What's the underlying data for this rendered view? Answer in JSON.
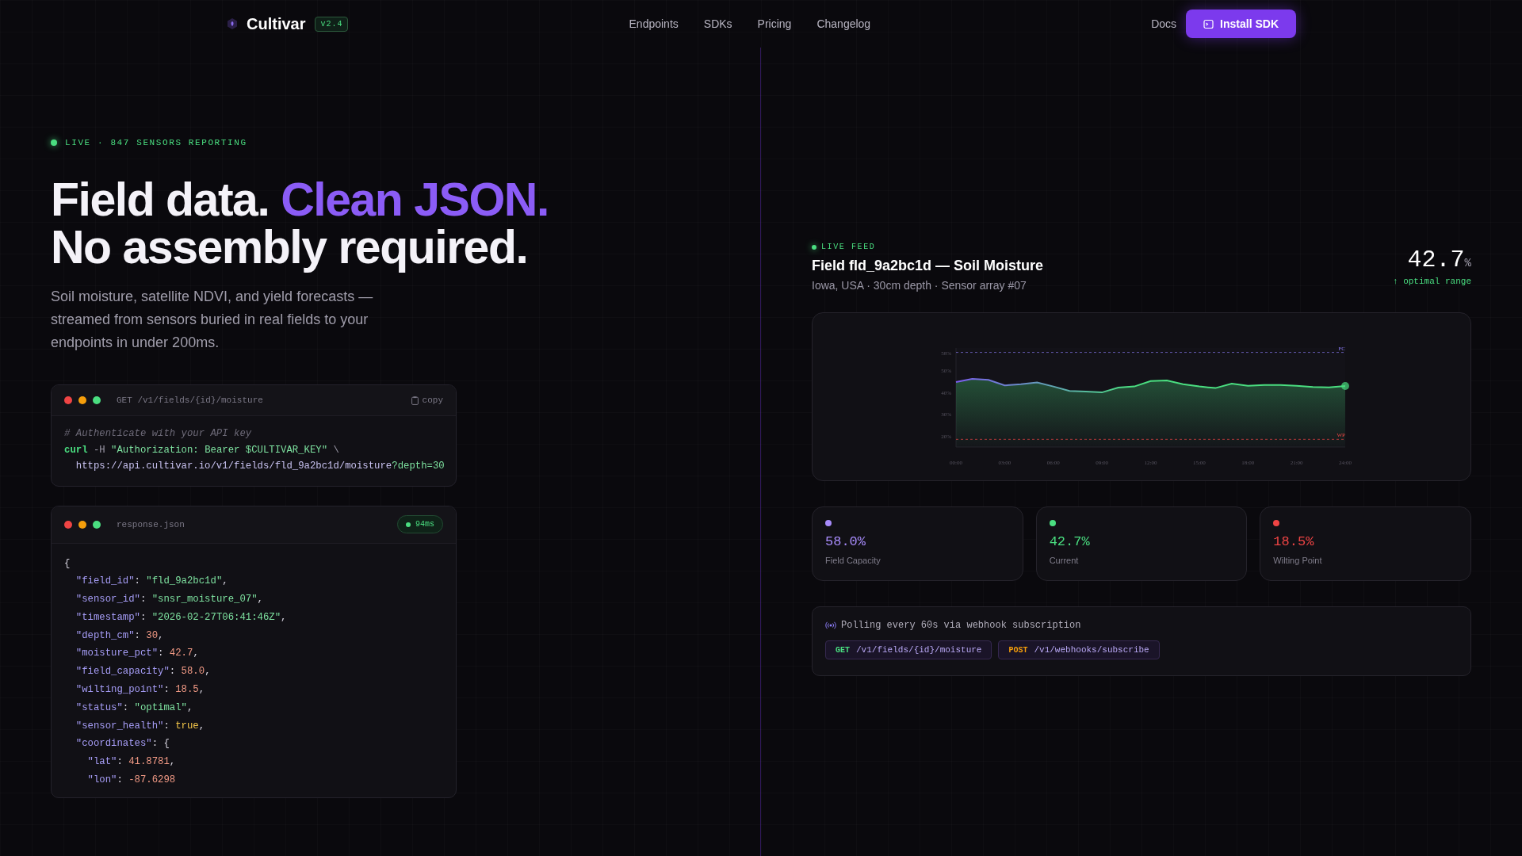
{
  "nav": {
    "brand": "Cultivar",
    "version": "v2.4",
    "links": [
      "Endpoints",
      "SDKs",
      "Pricing",
      "Changelog"
    ],
    "docs": "Docs",
    "cta": "Install SDK"
  },
  "hero": {
    "status": "LIVE · 847 SENSORS REPORTING",
    "title_start": "Field data.",
    "title_accent": "Clean JSON.",
    "title_end": "No assembly required.",
    "lead": "Soil moisture, satellite NDVI, and yield forecasts — streamed from sensors buried in real fields to your endpoints in under 200ms."
  },
  "request": {
    "title": "GET /v1/fields/{id}/moisture",
    "copy": "copy",
    "lines": [
      [
        {
          "t": "# Authenticate with your API key",
          "kind": "comment"
        }
      ],
      [
        {
          "t": "curl",
          "kind": "cmd"
        },
        {
          "t": " -H ",
          "kind": "plain"
        },
        {
          "t": "\"Authorization: Bearer $CULTIVAR_KEY\"",
          "kind": "string"
        },
        {
          "t": " \\",
          "kind": "plain"
        }
      ],
      [
        {
          "t": "  https://api.cultivar.io/v1/fields/fld_9a2bc1d/moisture",
          "kind": "url"
        },
        {
          "t": "?depth=30",
          "kind": "string"
        }
      ]
    ]
  },
  "response": {
    "title": "response.json",
    "latency": "94ms",
    "lines": [
      [
        {
          "t": "{",
          "kind": "punct"
        }
      ],
      [
        {
          "t": "  \"field_id\"",
          "kind": "key"
        },
        {
          "t": ": ",
          "kind": "punct"
        },
        {
          "t": "\"fld_9a2bc1d\"",
          "kind": "string"
        },
        {
          "t": ",",
          "kind": "punct"
        }
      ],
      [
        {
          "t": "  \"sensor_id\"",
          "kind": "key"
        },
        {
          "t": ": ",
          "kind": "punct"
        },
        {
          "t": "\"snsr_moisture_07\"",
          "kind": "string"
        },
        {
          "t": ",",
          "kind": "punct"
        }
      ],
      [
        {
          "t": "  \"timestamp\"",
          "kind": "key"
        },
        {
          "t": ": ",
          "kind": "punct"
        },
        {
          "t": "\"2026-02-27T06:41:46Z\"",
          "kind": "string"
        },
        {
          "t": ",",
          "kind": "punct"
        }
      ],
      [
        {
          "t": "  \"depth_cm\"",
          "kind": "key"
        },
        {
          "t": ": ",
          "kind": "punct"
        },
        {
          "t": "30",
          "kind": "number"
        },
        {
          "t": ",",
          "kind": "punct"
        }
      ],
      [
        {
          "t": "  \"moisture_pct\"",
          "kind": "key"
        },
        {
          "t": ": ",
          "kind": "punct"
        },
        {
          "t": "42.7",
          "kind": "number"
        },
        {
          "t": ",",
          "kind": "punct"
        }
      ],
      [
        {
          "t": "  \"field_capacity\"",
          "kind": "key"
        },
        {
          "t": ": ",
          "kind": "punct"
        },
        {
          "t": "58.0",
          "kind": "number"
        },
        {
          "t": ",",
          "kind": "punct"
        }
      ],
      [
        {
          "t": "  \"wilting_point\"",
          "kind": "key"
        },
        {
          "t": ": ",
          "kind": "punct"
        },
        {
          "t": "18.5",
          "kind": "number"
        },
        {
          "t": ",",
          "kind": "punct"
        }
      ],
      [
        {
          "t": "  \"status\"",
          "kind": "key"
        },
        {
          "t": ": ",
          "kind": "punct"
        },
        {
          "t": "\"optimal\"",
          "kind": "string"
        },
        {
          "t": ",",
          "kind": "punct"
        }
      ],
      [
        {
          "t": "  \"sensor_health\"",
          "kind": "key"
        },
        {
          "t": ": ",
          "kind": "punct"
        },
        {
          "t": "true",
          "kind": "boolean"
        },
        {
          "t": ",",
          "kind": "punct"
        }
      ],
      [
        {
          "t": "  \"coordinates\"",
          "kind": "key"
        },
        {
          "t": ": {",
          "kind": "punct"
        }
      ],
      [
        {
          "t": "    \"lat\"",
          "kind": "key"
        },
        {
          "t": ": ",
          "kind": "punct"
        },
        {
          "t": "41.8781",
          "kind": "number"
        },
        {
          "t": ",",
          "kind": "punct"
        }
      ],
      [
        {
          "t": "    \"lon\"",
          "kind": "key"
        },
        {
          "t": ": ",
          "kind": "punct"
        },
        {
          "t": "-87.6298",
          "kind": "number"
        }
      ]
    ]
  },
  "feed": {
    "status": "LIVE FEED",
    "title": "Field fld_9a2bc1d — Soil Moisture",
    "subtitle": "Iowa, USA · 30cm depth · Sensor array #07",
    "reading": "42.7",
    "unit": "%",
    "trend": "↑ optimal range",
    "chart_data": {
      "type": "area",
      "x": [
        0,
        1,
        2,
        3,
        4,
        5,
        6,
        7,
        8,
        9,
        10,
        11,
        12,
        13,
        14,
        15,
        16,
        17,
        18,
        19,
        20,
        21,
        22,
        23,
        24
      ],
      "series": [
        {
          "color": "#4ade80",
          "values": [
            44.5,
            46,
            45.5,
            43,
            43.5,
            44.3,
            42.5,
            40.5,
            40.2,
            39.8,
            42,
            42.5,
            45,
            45.2,
            43.5,
            42.5,
            41.8,
            43.8,
            42.8,
            43.2,
            43.2,
            42.8,
            42.3,
            42.1,
            42.7
          ]
        },
        {
          "name": "FC",
          "type": "line",
          "line_style": "dashed",
          "color": "#8b7cf6",
          "values": [
            58,
            58,
            58,
            58,
            58,
            58,
            58,
            58,
            58,
            58,
            58,
            58,
            58,
            58,
            58,
            58,
            58,
            58,
            58,
            58,
            58,
            58,
            58,
            58,
            58
          ]
        },
        {
          "name": "WP",
          "type": "line",
          "line_style": "dashed",
          "color": "#ef4444",
          "values": [
            18.5,
            18.5,
            18.5,
            18.5,
            18.5,
            18.5,
            18.5,
            18.5,
            18.5,
            18.5,
            18.5,
            18.5,
            18.5,
            18.5,
            18.5,
            18.5,
            18.5,
            18.5,
            18.5,
            18.5,
            18.5,
            18.5,
            18.5,
            18.5,
            18.5
          ]
        }
      ],
      "xlim": [
        0,
        24
      ],
      "ylim": [
        15,
        60
      ],
      "yticks": [
        {
          "value": 20,
          "label": "20%"
        },
        {
          "value": 30,
          "label": "30%"
        },
        {
          "value": 40,
          "label": "40%"
        },
        {
          "value": 50,
          "label": "50%"
        },
        {
          "value": 58,
          "label": "58%"
        }
      ],
      "xticks": [
        {
          "value": 0,
          "label": "00:00"
        },
        {
          "value": 3,
          "label": "03:00"
        },
        {
          "value": 6,
          "label": "06:00"
        },
        {
          "value": 9,
          "label": "09:00"
        },
        {
          "value": 12,
          "label": "12:00"
        },
        {
          "value": 15,
          "label": "15:00"
        },
        {
          "value": 18,
          "label": "18:00"
        },
        {
          "value": 21,
          "label": "21:00"
        },
        {
          "value": 24,
          "label": "24:00"
        }
      ]
    },
    "stats": [
      {
        "value": "58.0%",
        "label": "Field Capacity",
        "color": "#a78bfa"
      },
      {
        "value": "42.7%",
        "label": "Current",
        "color": "#4ade80"
      },
      {
        "value": "18.5%",
        "label": "Wilting Point",
        "color": "#ef4444"
      }
    ],
    "polling": {
      "text": "Polling every 60s via webhook subscription",
      "endpoints": [
        {
          "method": "GET",
          "path": "/v1/fields/{id}/moisture",
          "color": "#4ade80"
        },
        {
          "method": "POST",
          "path": "/v1/webhooks/subscribe",
          "color": "#f59e0b"
        }
      ]
    }
  }
}
